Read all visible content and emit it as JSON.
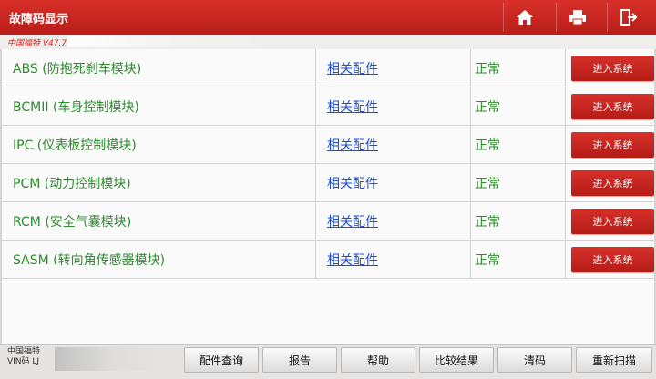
{
  "header": {
    "title": "故障码显示",
    "icons": [
      "home-icon",
      "print-icon",
      "exit-icon"
    ],
    "color": "#c8241e"
  },
  "subheader": {
    "version": "中国福特 V47.7"
  },
  "modules": [
    {
      "name": "ABS (防抱死刹车模块)",
      "parts_link": "相关配件",
      "status": "正常",
      "action": "进入系统"
    },
    {
      "name": "BCMII (车身控制模块)",
      "parts_link": "相关配件",
      "status": "正常",
      "action": "进入系统"
    },
    {
      "name": "IPC (仪表板控制模块)",
      "parts_link": "相关配件",
      "status": "正常",
      "action": "进入系统"
    },
    {
      "name": "PCM (动力控制模块)",
      "parts_link": "相关配件",
      "status": "正常",
      "action": "进入系统"
    },
    {
      "name": "RCM (安全气囊模块)",
      "parts_link": "相关配件",
      "status": "正常",
      "action": "进入系统"
    },
    {
      "name": "SASM (转向角传感器模块)",
      "parts_link": "相关配件",
      "status": "正常",
      "action": "进入系统"
    }
  ],
  "footer": {
    "vehicle_line1": "中国福特",
    "vehicle_line2": "VIN码 LJ",
    "buttons": [
      "配件查询",
      "报告",
      "帮助",
      "比较结果",
      "清码",
      "重新扫描"
    ]
  }
}
